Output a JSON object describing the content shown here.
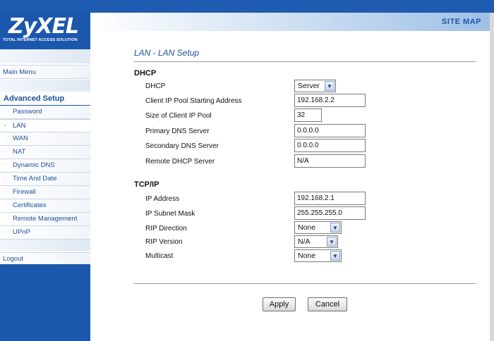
{
  "header": {
    "logo": "ZyXEL",
    "tagline": "TOTAL INTERNET ACCESS SOLUTION",
    "site_map": "SITE MAP",
    "brand_color": "#1b57ac"
  },
  "sidebar": {
    "main_menu": "Main Menu",
    "advanced_setup": "Advanced Setup",
    "items": [
      {
        "label": "Password",
        "icon": "bullet-icon"
      },
      {
        "label": "LAN",
        "icon": "bullet-icon",
        "active": true
      },
      {
        "label": "WAN",
        "icon": "bullet-icon"
      },
      {
        "label": "NAT",
        "icon": "bullet-icon"
      },
      {
        "label": "Dynamic DNS",
        "icon": "bullet-icon"
      },
      {
        "label": "Time And Date",
        "icon": "bullet-icon"
      },
      {
        "label": "Firewall",
        "icon": "bullet-icon"
      },
      {
        "label": "Certificates",
        "icon": "bullet-icon"
      },
      {
        "label": "Remote Management",
        "icon": "bullet-icon"
      },
      {
        "label": "UPnP",
        "icon": "bullet-icon"
      }
    ],
    "logout": "Logout"
  },
  "main": {
    "title": "LAN - LAN Setup",
    "dhcp": {
      "heading": "DHCP",
      "dhcp_label": "DHCP",
      "dhcp_value": "Server",
      "pool_start_label": "Client IP Pool Starting Address",
      "pool_start_value": "192.168.2.2",
      "pool_size_label": "Size of Client IP Pool",
      "pool_size_value": "32",
      "primary_dns_label": "Primary DNS Server",
      "primary_dns_value": "0.0.0.0",
      "secondary_dns_label": "Secondary DNS Server",
      "secondary_dns_value": "0.0.0.0",
      "remote_dhcp_label": "Remote DHCP Server",
      "remote_dhcp_value": "N/A"
    },
    "tcpip": {
      "heading": "TCP/IP",
      "ip_label": "IP Address",
      "ip_value": "192.168.2.1",
      "mask_label": "IP Subnet Mask",
      "mask_value": "255.255.255.0",
      "rip_dir_label": "RIP Direction",
      "rip_dir_value": "None",
      "rip_ver_label": "RIP Version",
      "rip_ver_value": "N/A",
      "multicast_label": "Multicast",
      "multicast_value": "None"
    },
    "apply": "Apply",
    "cancel": "Cancel"
  }
}
